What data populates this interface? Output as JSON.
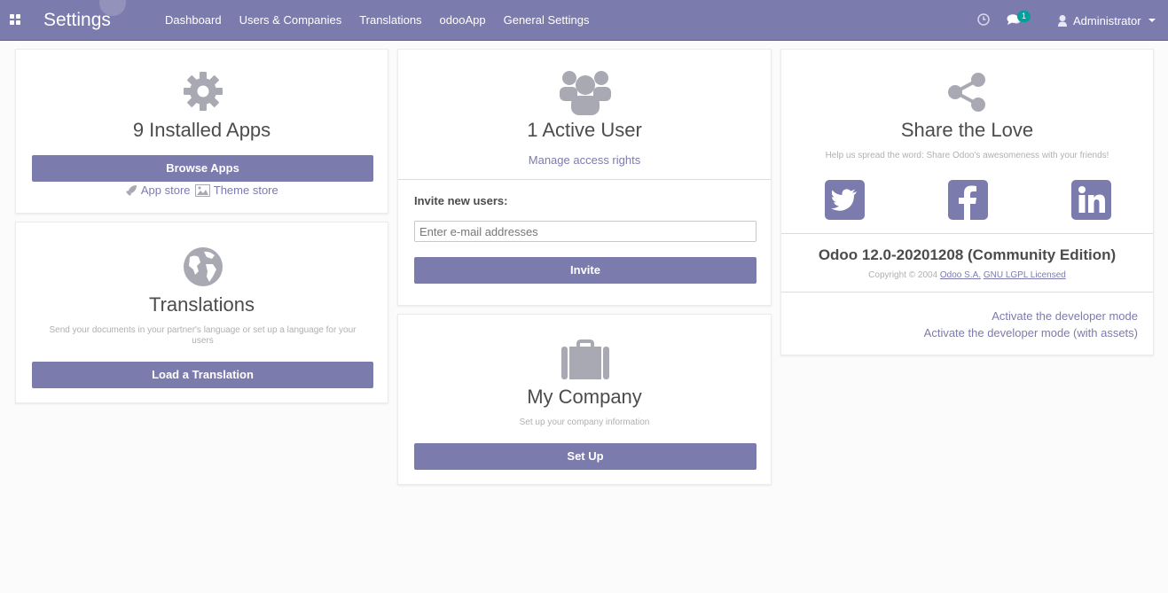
{
  "navbar": {
    "brand": "Settings",
    "menu": [
      "Dashboard",
      "Users & Companies",
      "Translations",
      "odooApp",
      "General Settings"
    ],
    "chat_badge": "1",
    "user": "Administrator"
  },
  "apps": {
    "title": "9 Installed Apps",
    "button": "Browse Apps",
    "app_store": "App store",
    "theme_store": "Theme store"
  },
  "translations": {
    "title": "Translations",
    "desc": "Send your documents in your partner's language or set up a language for your users",
    "button": "Load a Translation"
  },
  "users": {
    "title": "1 Active User",
    "manage": "Manage access rights",
    "invite_label": "Invite new users:",
    "invite_placeholder": "Enter e-mail addresses",
    "invite_button": "Invite"
  },
  "company": {
    "title": "My Company",
    "desc": "Set up your company information",
    "button": "Set Up"
  },
  "share": {
    "title": "Share the Love",
    "desc": "Help us spread the word: Share Odoo's awesomeness with your friends!",
    "version": "Odoo 12.0-20201208 (Community Edition)",
    "copyright_prefix": "Copyright © 2004",
    "company_link": "Odoo S.A.",
    "license_link": "GNU LGPL Licensed",
    "dev_mode": "Activate the developer mode",
    "dev_mode_assets": "Activate the developer mode (with assets)"
  },
  "colors": {
    "primary": "#7c7bad",
    "icon_gray": "#a9a9b3",
    "badge": "#00a09d"
  }
}
